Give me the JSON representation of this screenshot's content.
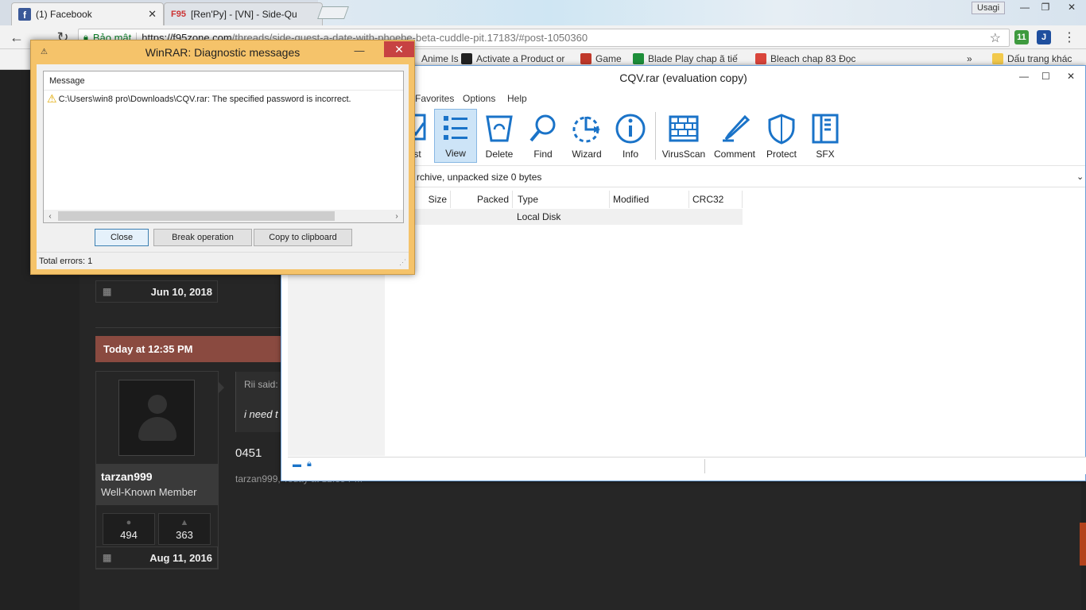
{
  "browser": {
    "tabs": [
      {
        "label": "(1) Facebook",
        "icon": "facebook-icon"
      },
      {
        "label": "[Ren'Py] - [VN] - Side-Qu",
        "icon": "f95-icon",
        "icon_text": "F95"
      }
    ],
    "user_name": "Usagi",
    "address": {
      "secure_label": "Bảo mật",
      "url_host": "https://f95zone.com",
      "url_path": "/threads/side-quest-a-date-with-phoebe-beta-cuddle-pit.17183/#post-1050360"
    },
    "ext_badge": "11",
    "bookmarks": [
      {
        "label": "Anime Is"
      },
      {
        "label": "Activate a Product or"
      },
      {
        "label": "Game"
      },
      {
        "label": "Blade Play chap ã tiế"
      },
      {
        "label": "Bleach chap 83 Đọc"
      },
      {
        "label": "Dấu trang khác"
      }
    ],
    "bookmarks_more": "»"
  },
  "forum": {
    "prev_join_date": "Jun 10, 2018",
    "post_date": "Today at 12:35 PM",
    "user": {
      "name": "tarzan999",
      "title": "Well-Known Member",
      "messages": "494",
      "likes": "363",
      "join_date": "Aug 11, 2016"
    },
    "quote_author": "Rii said:",
    "quote_text": "i need t",
    "post_text": "0451",
    "post_meta": "tarzan999, Today at 12:35 PM"
  },
  "winrar": {
    "title": "CQV.rar (evaluation copy)",
    "menu": [
      "Favorites",
      "Options",
      "Help"
    ],
    "toolbar": [
      {
        "label": "st",
        "icon": "test-icon"
      },
      {
        "label": "View",
        "icon": "view-icon"
      },
      {
        "label": "Delete",
        "icon": "delete-icon"
      },
      {
        "label": "Find",
        "icon": "find-icon"
      },
      {
        "label": "Wizard",
        "icon": "wizard-icon"
      },
      {
        "label": "Info",
        "icon": "info-icon"
      },
      {
        "label": "VirusScan",
        "icon": "virusscan-icon"
      },
      {
        "label": "Comment",
        "icon": "comment-icon"
      },
      {
        "label": "Protect",
        "icon": "protect-icon"
      },
      {
        "label": "SFX",
        "icon": "sfx-icon"
      }
    ],
    "path_text": "rchive, unpacked size 0 bytes",
    "columns": [
      "Size",
      "Packed",
      "Type",
      "Modified",
      "CRC32"
    ],
    "row": {
      "type": "Local Disk"
    },
    "accent": "#1a73c8"
  },
  "dialog": {
    "title": "WinRAR: Diagnostic messages",
    "column_header": "Message",
    "message": "C:\\Users\\win8 pro\\Downloads\\CQV.rar: The specified password is incorrect.",
    "buttons": {
      "close": "Close",
      "break": "Break operation",
      "copy": "Copy to clipboard"
    },
    "footer": "Total errors: 1",
    "frame_color": "#f5c36a"
  }
}
